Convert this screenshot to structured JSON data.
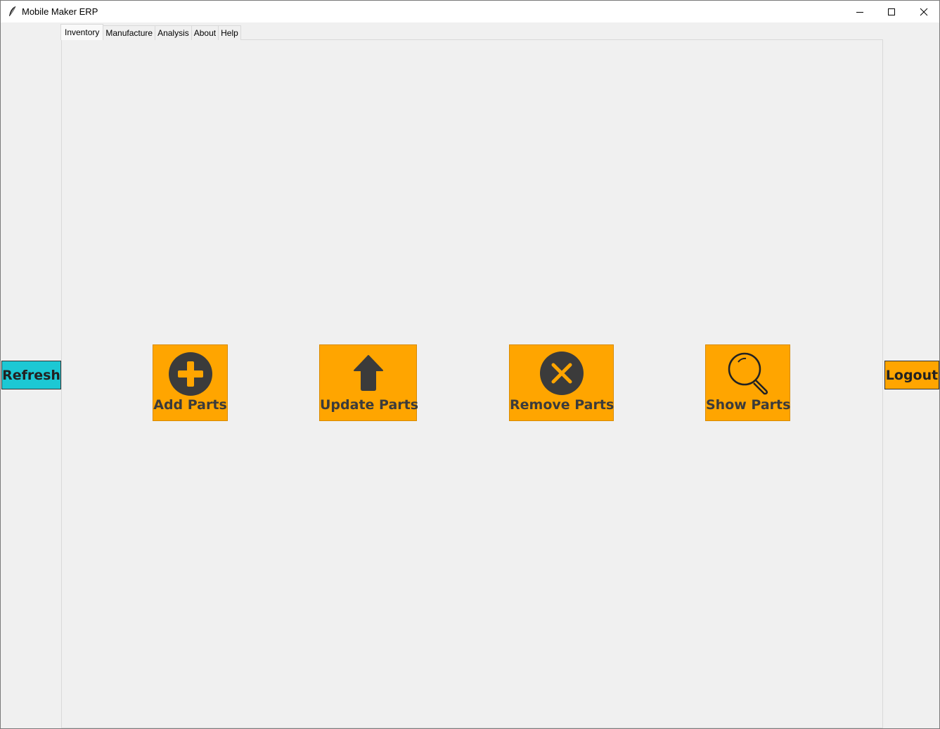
{
  "window": {
    "title": "Mobile Maker ERP",
    "controls": [
      "minimize-icon",
      "maximize-icon",
      "close-icon"
    ]
  },
  "tabs": [
    {
      "label": "Inventory",
      "active": true
    },
    {
      "label": "Manufacture",
      "active": false
    },
    {
      "label": "Analysis",
      "active": false
    },
    {
      "label": "About",
      "active": false
    },
    {
      "label": "Help",
      "active": false
    }
  ],
  "side_buttons": {
    "refresh_label": "Refresh",
    "logout_label": "Logout"
  },
  "actions": [
    {
      "label": "Add Parts",
      "icon": "plus-circle-icon"
    },
    {
      "label": "Update Parts",
      "icon": "arrow-up-icon"
    },
    {
      "label": "Remove Parts",
      "icon": "x-circle-icon"
    },
    {
      "label": "Show Parts",
      "icon": "magnifier-icon"
    }
  ],
  "colors": {
    "action_bg": "#ffa500",
    "refresh_bg": "#1cc8d4",
    "logout_bg": "#ffa500",
    "icon_dark": "#3b3b3b",
    "window_bg": "#f0f0f0"
  }
}
